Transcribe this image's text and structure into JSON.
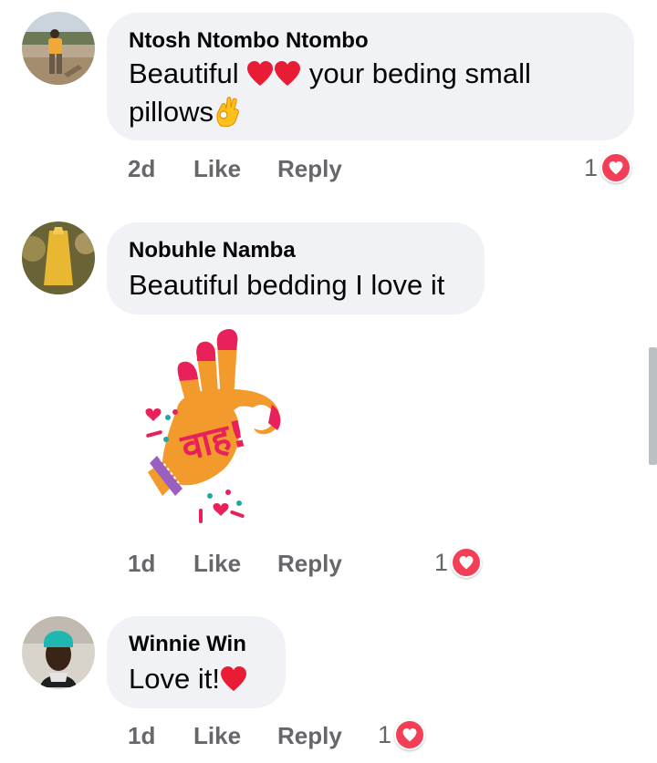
{
  "comments": [
    {
      "author": "Ntosh Ntombo Ntombo",
      "text_part1": "Beautiful",
      "text_part2": "your beding small",
      "text_part3": "pillows",
      "time": "2d",
      "like_label": "Like",
      "reply_label": "Reply",
      "reaction_count": "1"
    },
    {
      "author": "Nobuhle Namba",
      "text": "Beautiful bedding I love it",
      "sticker_text": "वाह!",
      "time": "1d",
      "like_label": "Like",
      "reply_label": "Reply",
      "reaction_count": "1"
    },
    {
      "author": "Winnie Win",
      "text": "Love it!",
      "time": "1d",
      "like_label": "Like",
      "reply_label": "Reply",
      "reaction_count": "1"
    }
  ],
  "colors": {
    "bubble": "#f0f2f5",
    "meta": "#65676b",
    "love_reaction": "#f33e58",
    "sticker_orange": "#f39a2d",
    "sticker_pink": "#e8215a"
  },
  "icons": [
    "red-heart-emoji",
    "ok-hand-emoji",
    "love-reaction-icon",
    "ok-hand-sticker"
  ]
}
